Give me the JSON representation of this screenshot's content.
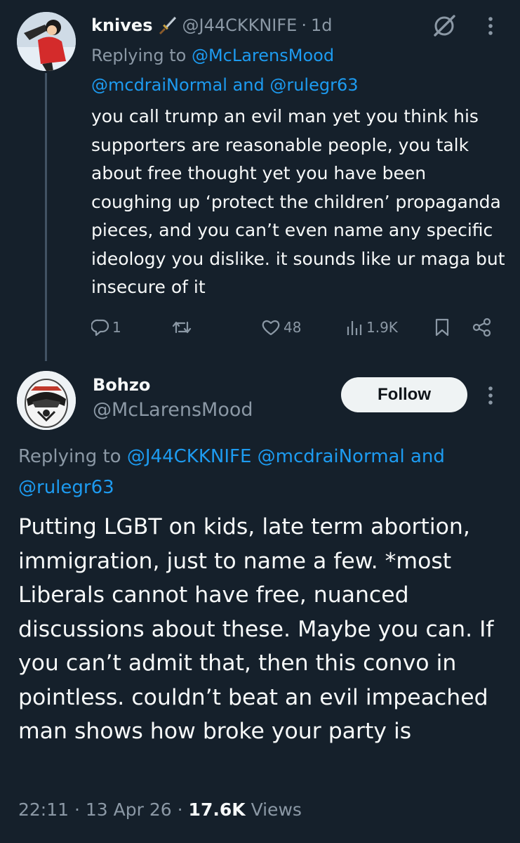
{
  "reply": {
    "name": "knives",
    "handle": "@J44CKKNIFE",
    "time": "1d",
    "replying_prefix": "Replying to",
    "mention_1": "@McLarensMood",
    "mention_2": "@mcdraiNormal",
    "and_text": "and",
    "mention_3": "@rulegr63",
    "text": "you call trump an evil man yet you think his supporters are reasonable people, you talk about free thought yet you have been coughing up ‘protect the children’ propaganda pieces, and you can’t even name any specific ideology you dislike. it sounds like ur maga but insecure of it",
    "stats": {
      "replies": "1",
      "retweets": "",
      "likes": "48",
      "views": "1.9K"
    },
    "icons": {
      "knife": "dagger-icon",
      "grok": "grok-icon",
      "more": "more-vertical-icon",
      "reply": "reply-icon",
      "retweet": "retweet-icon",
      "like": "heart-icon",
      "views": "views-icon",
      "bookmark": "bookmark-icon",
      "share": "share-icon"
    }
  },
  "main": {
    "name": "Bohzo",
    "handle": "@McLarensMood",
    "follow_label": "Follow",
    "replying_prefix": "Replying to",
    "mention_1": "@J44CKKNIFE",
    "mention_2": "@mcdraiNormal",
    "and_text": "and",
    "mention_3": "@rulegr63",
    "text": "Putting LGBT on kids, late term abortion, immigration, just to name a few. *most Liberals cannot have free, nuanced discussions about these. Maybe you can. If you can’t admit that, then this convo in pointless. couldn’t beat an evil impeached man shows how broke your party is",
    "time": "22:11",
    "date": "13 Apr 26",
    "views_count": "17.6K",
    "views_label": "Views"
  },
  "colors": {
    "background": "#15202b",
    "text": "#f7f9f9",
    "secondary": "#8b98a5",
    "link": "#1d9bf0",
    "thread_line": "#425364",
    "button_bg": "#eff3f4"
  }
}
